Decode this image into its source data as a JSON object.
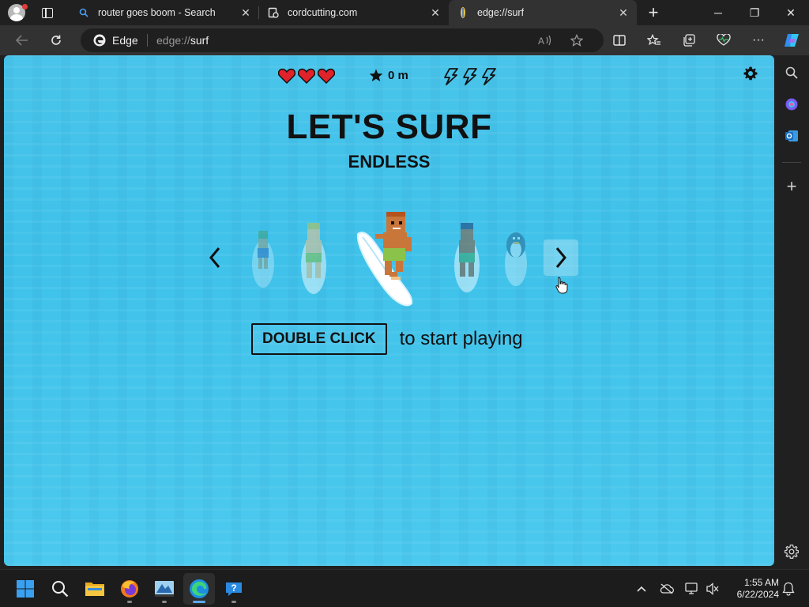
{
  "tabs": [
    {
      "label": "router goes boom - Search",
      "favicon": "search-icon",
      "active": false
    },
    {
      "label": "cordcutting.com",
      "favicon": "page-icon",
      "active": false
    },
    {
      "label": "edge://surf",
      "favicon": "surf-icon",
      "active": true
    }
  ],
  "window_controls": {
    "minimize": "─",
    "restore": "❐",
    "close": "✕"
  },
  "toolbar": {
    "edge_label": "Edge",
    "url_prefix": "edge://",
    "url_path": "surf"
  },
  "game": {
    "lives": 3,
    "distance": "0 m",
    "boosts": 3,
    "title": "LET'S SURF",
    "mode": "ENDLESS",
    "start_button": "DOUBLE CLICK",
    "start_text": "to start playing",
    "characters": [
      "surfer-1",
      "surfer-2",
      "surfer-3-selected",
      "surfer-4",
      "penguin"
    ]
  },
  "taskbar": {
    "apps": [
      "start-icon",
      "search-icon",
      "file-explorer-icon",
      "firefox-icon",
      "app-icon",
      "edge-icon",
      "help-icon"
    ],
    "time": "1:55 AM",
    "date": "6/22/2024"
  },
  "colors": {
    "water": "#45c4ec",
    "heart": "#e0222a",
    "text": "#111111"
  }
}
